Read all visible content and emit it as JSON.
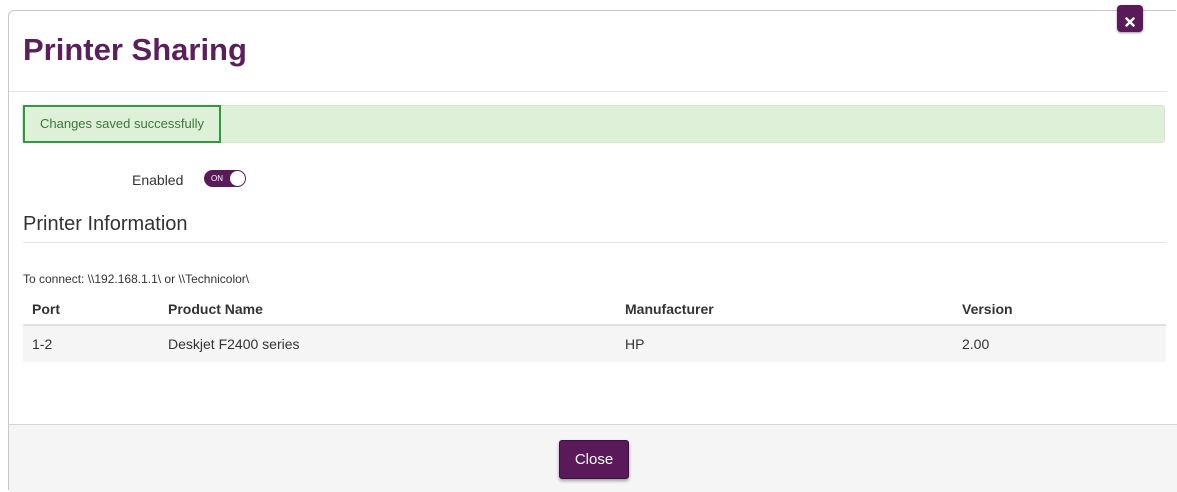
{
  "dialog": {
    "title": "Printer Sharing",
    "close_icon": "close-icon",
    "close_label": "Close"
  },
  "alert": {
    "message": "Changes saved successfully"
  },
  "sharing": {
    "enabled_label": "Enabled",
    "toggle_state": "ON"
  },
  "printer_info": {
    "heading": "Printer Information",
    "connect_text": "To connect: \\\\192.168.1.1\\ or \\\\Technicolor\\",
    "columns": [
      "Port",
      "Product Name",
      "Manufacturer",
      "Version"
    ],
    "rows": [
      [
        "1-2",
        "Deskjet F2400 series",
        "HP",
        "2.00"
      ]
    ]
  },
  "colors": {
    "brand_purple": "#5a1a5a",
    "title_purple": "#5b1f5b",
    "success_bg": "#dff0d8",
    "success_text": "#3c763d",
    "highlight_green": "#2e9a3e"
  }
}
